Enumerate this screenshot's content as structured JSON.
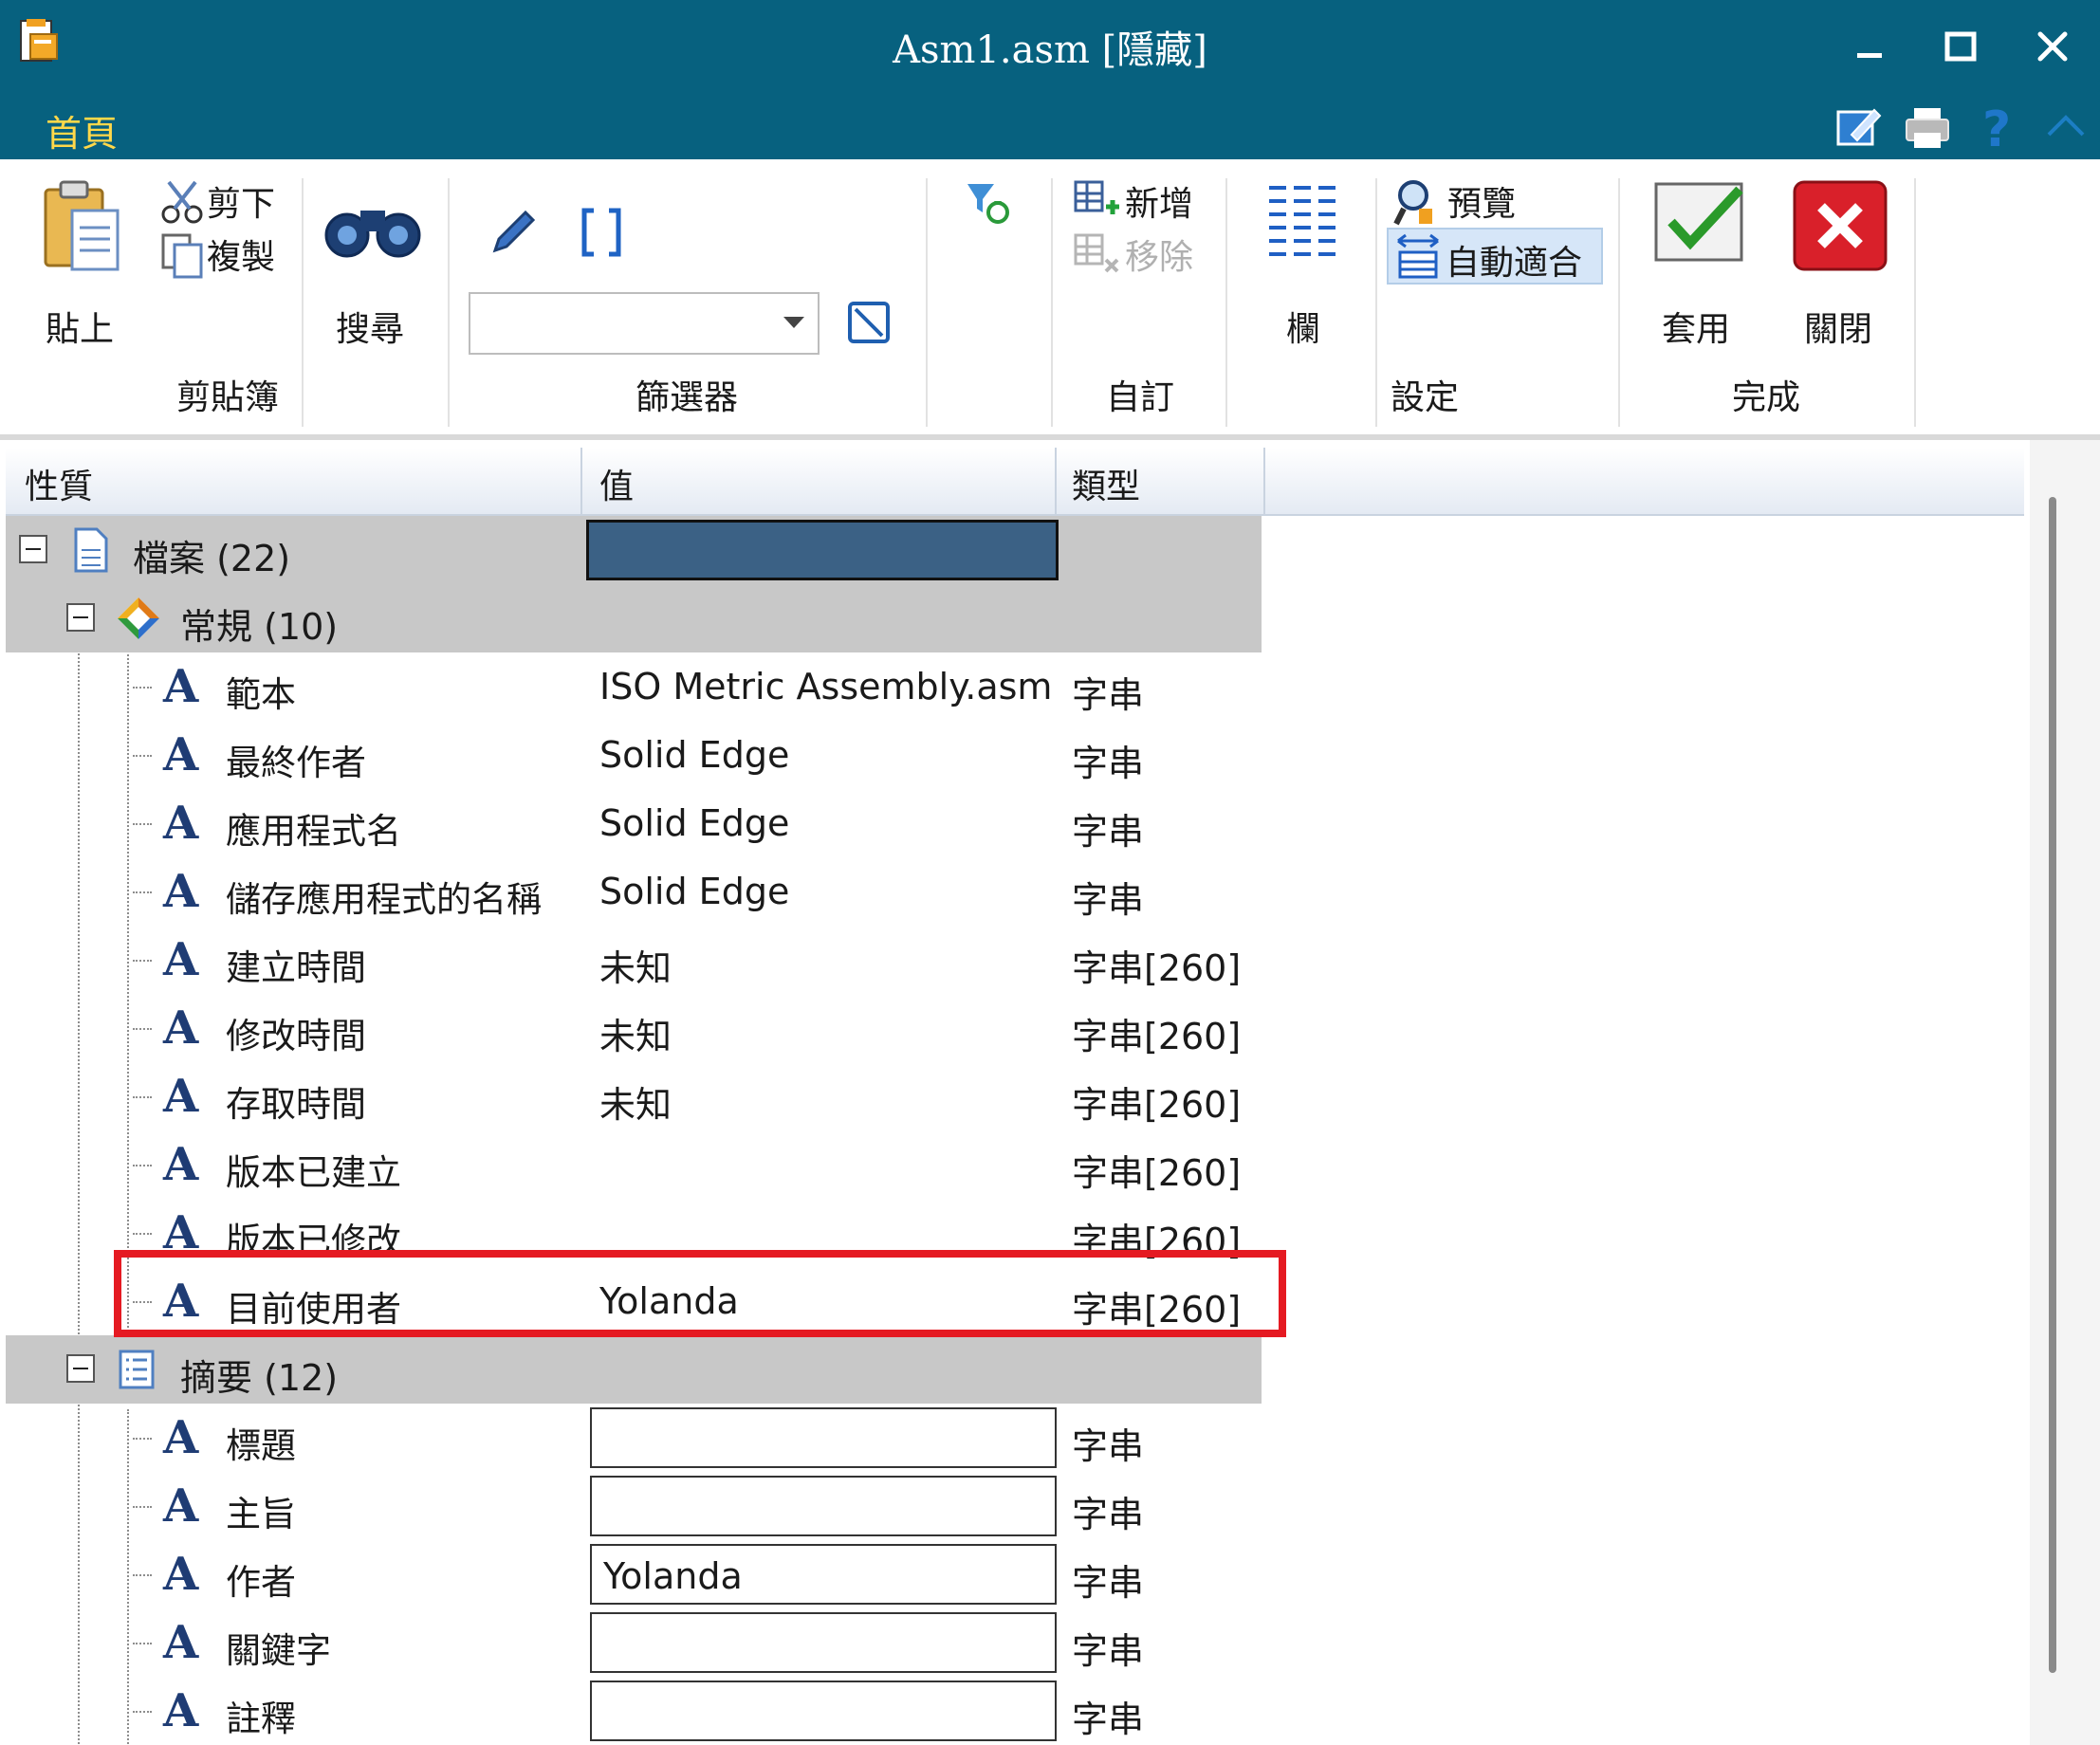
{
  "window": {
    "title": "Asm1.asm [隱藏]",
    "minimize_icon": "minimize-icon",
    "maximize_icon": "maximize-icon",
    "close_icon": "close-icon"
  },
  "tabs": {
    "home": "首頁"
  },
  "quick_access": [
    "edit-icon",
    "printer-icon",
    "help-icon",
    "collapse-ribbon-icon"
  ],
  "ribbon": {
    "clipboard": {
      "paste": "貼上",
      "cut": "剪下",
      "copy": "複製",
      "group": "剪貼簿"
    },
    "search": {
      "label": "搜尋"
    },
    "filter": {
      "value": "",
      "group": "篩選器"
    },
    "custom": {
      "add": "新增",
      "remove": "移除",
      "group": "自訂"
    },
    "columns": {
      "label": "欄"
    },
    "settings": {
      "preview": "預覽",
      "autofit": "自動適合",
      "group": "設定"
    },
    "done": {
      "apply": "套用",
      "close": "關閉",
      "group": "完成"
    }
  },
  "grid": {
    "headers": {
      "property": "性質",
      "value": "值",
      "type": "類型"
    },
    "groups": {
      "file": "檔案 (22)",
      "general": "常規 (10)",
      "summary": "摘要 (12)"
    },
    "general_rows": [
      {
        "name": "範本",
        "value": "ISO Metric Assembly.asm",
        "type": "字串"
      },
      {
        "name": "最終作者",
        "value": "Solid Edge",
        "type": "字串"
      },
      {
        "name": "應用程式名",
        "value": "Solid Edge",
        "type": "字串"
      },
      {
        "name": "儲存應用程式的名稱",
        "value": "Solid Edge",
        "type": "字串"
      },
      {
        "name": "建立時間",
        "value": "未知",
        "type": "字串[260]"
      },
      {
        "name": "修改時間",
        "value": "未知",
        "type": "字串[260]"
      },
      {
        "name": "存取時間",
        "value": "未知",
        "type": "字串[260]"
      },
      {
        "name": "版本已建立",
        "value": "",
        "type": "字串[260]"
      },
      {
        "name": "版本已修改",
        "value": "",
        "type": "字串[260]"
      },
      {
        "name": "目前使用者",
        "value": "Yolanda",
        "type": "字串[260]"
      }
    ],
    "summary_rows": [
      {
        "name": "標題",
        "value": "",
        "type": "字串"
      },
      {
        "name": "主旨",
        "value": "",
        "type": "字串"
      },
      {
        "name": "作者",
        "value": "Yolanda",
        "type": "字串"
      },
      {
        "name": "關鍵字",
        "value": "",
        "type": "字串"
      },
      {
        "name": "註釋",
        "value": "",
        "type": "字串"
      }
    ]
  },
  "colors": {
    "titlebar": "#07617f",
    "tab_text": "#ffd84a",
    "highlight": "#e51a22",
    "group_row": "#c8c8c8"
  }
}
